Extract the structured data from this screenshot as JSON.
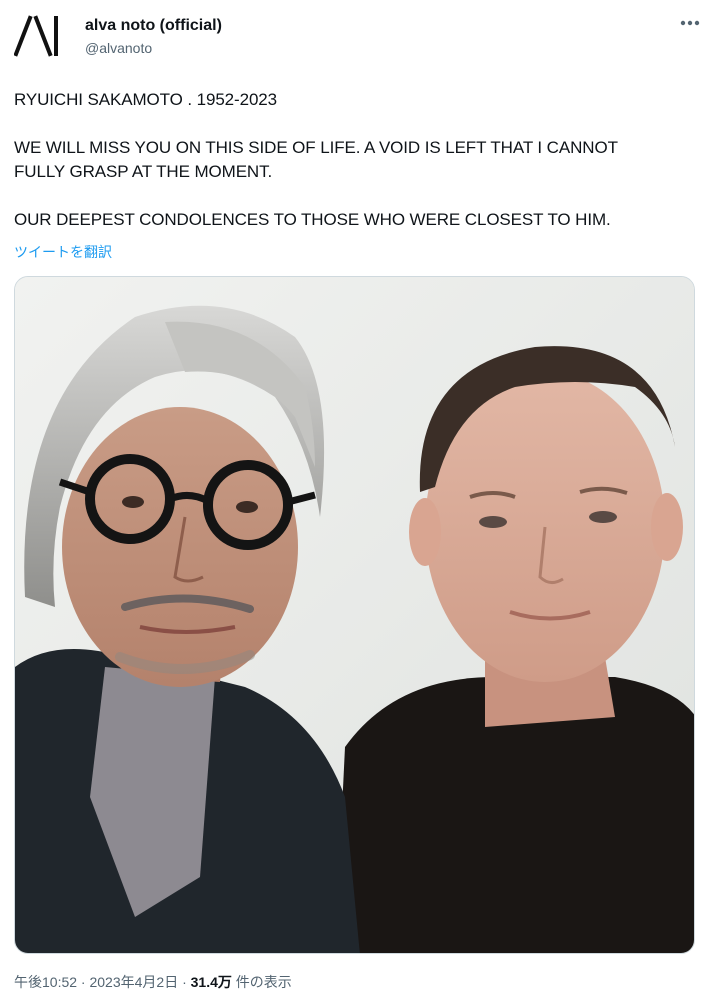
{
  "author": {
    "name": "alva noto (official)",
    "handle": "@alvanoto",
    "avatar_icon": "alva-noto-logo-icon"
  },
  "more_icon": "more-options-icon",
  "tweet": {
    "line1": "RYUICHI SAKAMOTO . 1952-2023",
    "line2a": "WE WILL MISS YOU ON THIS SIDE OF LIFE. A VOID IS LEFT THAT I CANNOT",
    "line2b": "FULLY GRASP AT THE MOMENT.",
    "line3": "OUR DEEPEST CONDOLENCES TO THOSE WHO WERE CLOSEST TO HIM."
  },
  "translate_label": "ツイートを翻訳",
  "meta": {
    "timestamp": "午後10:52 · 2023年4月2日 · ",
    "views_count": "31.4万",
    "views_label": " 件の表示"
  },
  "colors": {
    "link": "#1d9bf0",
    "secondary_text": "#536471",
    "primary_text": "#0f1419"
  }
}
